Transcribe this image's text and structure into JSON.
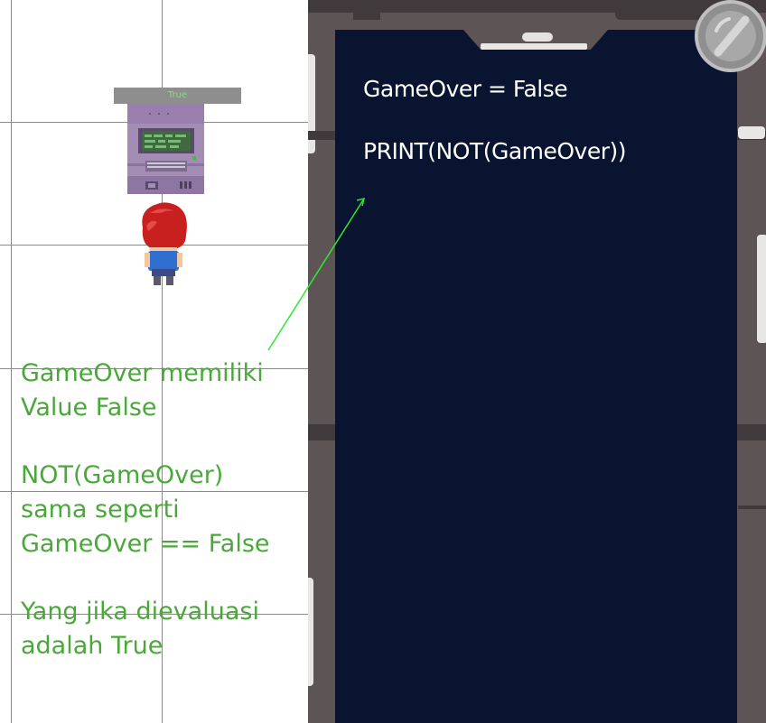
{
  "game": {
    "terminal_status": "True"
  },
  "annotation": {
    "lines_group1": [
      "GameOver memiliki",
      "Value False"
    ],
    "lines_group2": [
      "NOT(GameOver)",
      "sama seperti",
      "GameOver == False"
    ],
    "lines_group3": [
      "Yang jika dievaluasi",
      "adalah True"
    ]
  },
  "code_panel": {
    "line1": "GameOver = False",
    "line2": "PRINT(NOT(GameOver))"
  },
  "colors": {
    "annotation": "#4aa83a",
    "screen_bg": "#081430",
    "terminal_label_text": "#7de27d"
  },
  "icons": {
    "close": "slash-circle-icon"
  }
}
